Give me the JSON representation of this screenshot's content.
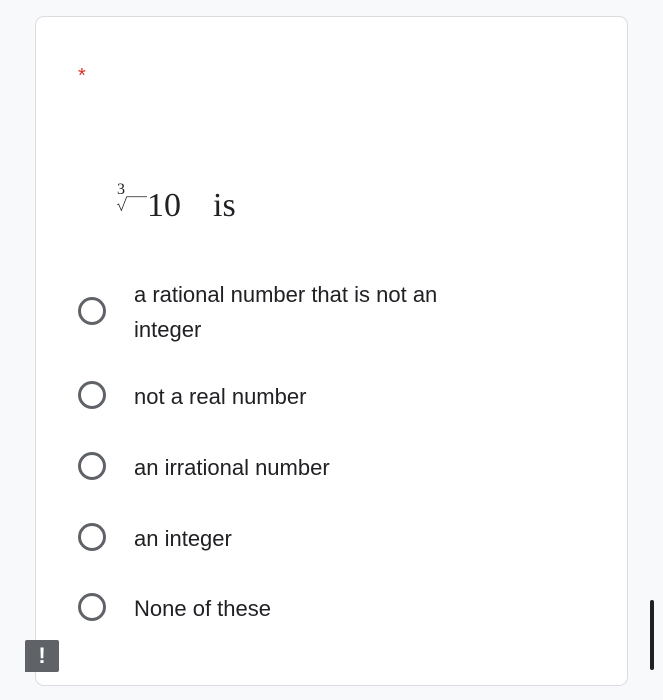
{
  "question": {
    "required_marker": "*",
    "root_index": "3",
    "radicand": "10",
    "text": "is"
  },
  "options": [
    {
      "label": "a rational number that is not an integer",
      "selected": false
    },
    {
      "label": "not a real number",
      "selected": false
    },
    {
      "label": "an irrational number",
      "selected": false
    },
    {
      "label": "an integer",
      "selected": false
    },
    {
      "label": "None of these",
      "selected": false
    }
  ],
  "feedback": {
    "label": "!"
  },
  "colors": {
    "required": "#d93025",
    "radio_border": "#5f6368",
    "text": "#202124",
    "card_border": "#dadce0"
  }
}
